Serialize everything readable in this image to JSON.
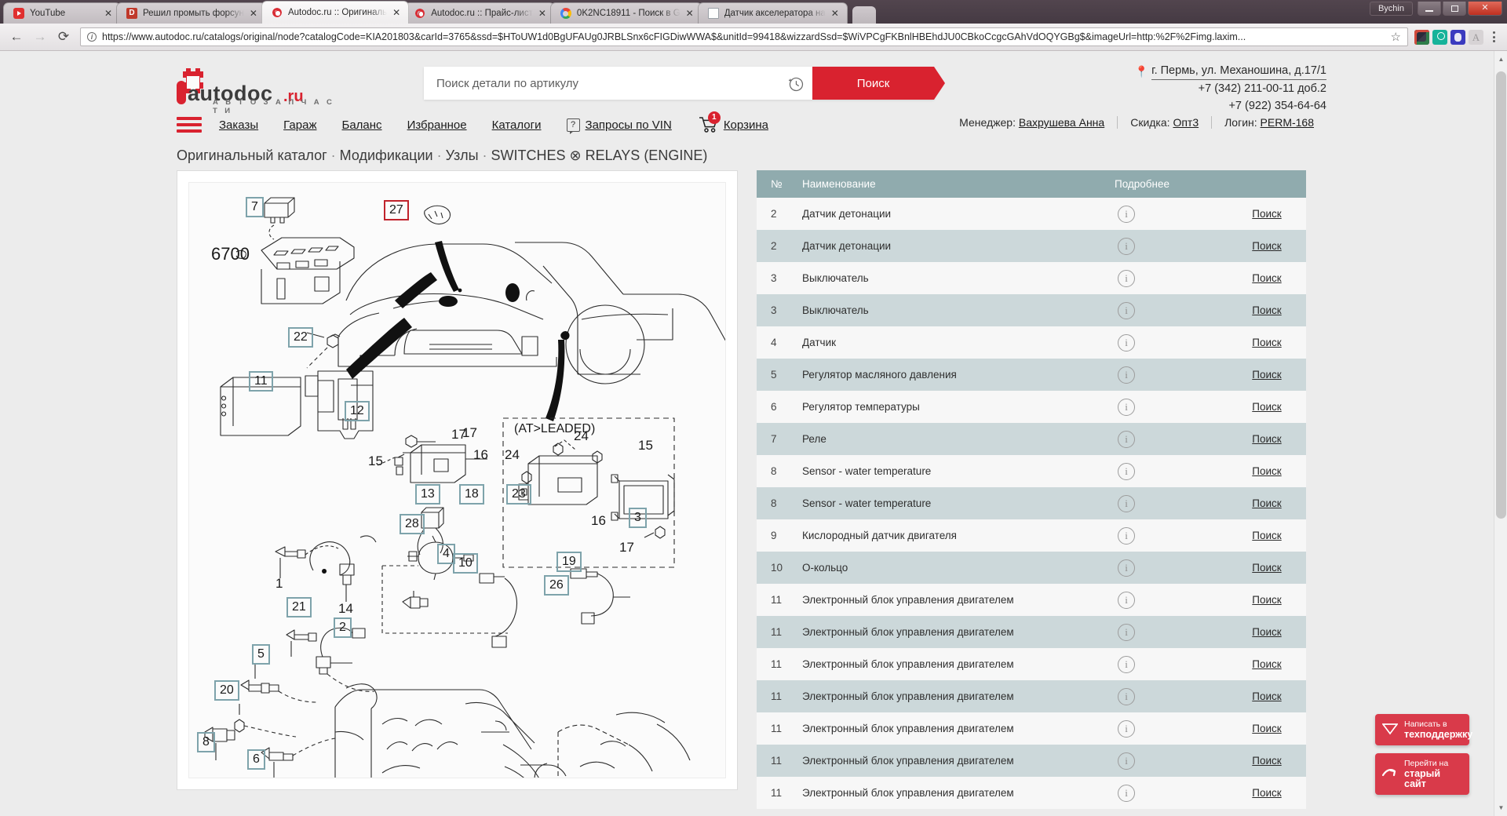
{
  "browser": {
    "tabs": [
      {
        "title": "YouTube",
        "icon": "youtube-icon",
        "active": false
      },
      {
        "title": "Решил промыть форсун",
        "icon": "drive2-icon",
        "active": false
      },
      {
        "title": "Autodoc.ru :: Оригиналь",
        "icon": "autodoc-icon",
        "active": true
      },
      {
        "title": "Autodoc.ru :: Прайс-лист",
        "icon": "autodoc-icon",
        "active": false
      },
      {
        "title": "0K2NC18911 - Поиск в G",
        "icon": "google-icon",
        "active": false
      },
      {
        "title": "Датчик акселератора на",
        "icon": "page-icon",
        "active": false
      }
    ],
    "tab_close_label": "✕",
    "user_chip": "Bychin",
    "window_buttons": {
      "minimize": "—",
      "maximize": "❐",
      "close": "✕"
    },
    "url": "https://www.autodoc.ru/catalogs/original/node?catalogCode=KIA201803&carId=3765&ssd=$HToUW1d0BgUFAUg0JRBLSnx6cFIGDiwWWA$&unitId=99418&wizzardSsd=$WiVPCgFKBnlHBEhdJU0CBkoCcgcGAhVdOQYGBg$&imageUrl=http:%2F%2Fimg.laxim...",
    "nav": {
      "back": "←",
      "forward": "→",
      "reload": "C"
    },
    "extensions": [
      "puzzle-extension-icon",
      "adguard-icon",
      "music-extension-icon",
      "pdf-extension-icon"
    ],
    "menu": "kebab-menu-icon"
  },
  "site": {
    "logo": {
      "name": "autodoc",
      "domain": ".ru",
      "tagline": "А В Т О З А П Ч А С Т И"
    },
    "search": {
      "placeholder": "Поиск детали по артикулу",
      "value": "",
      "button": "Поиск",
      "history_icon": "history-clock-icon"
    },
    "contact": {
      "address": "г. Пермь, ул. Механошина, д.17/1",
      "phone1": "+7 (342) 211-00-11 доб.2",
      "phone2": "+7 (922) 354-64-64"
    },
    "nav": {
      "menu_icon": "burger-menu-icon",
      "items": [
        {
          "label": "Заказы",
          "name": "nav-orders"
        },
        {
          "label": "Гараж",
          "name": "nav-garage"
        },
        {
          "label": "Баланс",
          "name": "nav-balance"
        },
        {
          "label": "Избранное",
          "name": "nav-favorites"
        },
        {
          "label": "Каталоги",
          "name": "nav-catalogs"
        }
      ],
      "vin": {
        "label": "Запросы по VIN",
        "icon": "question-tooltip-icon"
      },
      "cart": {
        "label": "Корзина",
        "count": "1",
        "icon": "cart-icon"
      }
    },
    "account": {
      "manager_label": "Менеджер:",
      "manager_name": "Вахрушева Анна",
      "discount_label": "Скидка:",
      "discount_value": "Опт3",
      "login_label": "Логин:",
      "login_value": "PERM-168"
    },
    "breadcrumb": {
      "items": [
        "Оригинальный каталог",
        "Модификации",
        "Узлы",
        "SWITCHES ⊗ RELAYS (ENGINE)"
      ],
      "separator": "·"
    },
    "float_buttons": [
      {
        "line1": "Написать в",
        "line2": "техподдержку",
        "icon": "send-plane-icon"
      },
      {
        "line1": "Перейти на",
        "line2": "старый сайт",
        "icon": "arrow-right-icon"
      }
    ]
  },
  "diagram": {
    "title": "SWITCHES ⊗ RELAYS (ENGINE)",
    "inset_label": "(AT>LEADED)",
    "plain_labels": [
      "6700",
      "24",
      "24",
      "15",
      "16",
      "17",
      "15",
      "16",
      "17",
      "1",
      "14"
    ],
    "highlighted_callout": "27",
    "callouts": [
      "7",
      "27",
      "6700",
      "22",
      "11",
      "12",
      "15",
      "17",
      "16",
      "24",
      "15",
      "16",
      "17",
      "13",
      "18",
      "23",
      "3",
      "1",
      "14",
      "28",
      "4",
      "10",
      "21",
      "2",
      "5",
      "19",
      "26",
      "20",
      "8",
      "6"
    ]
  },
  "table": {
    "columns": [
      "№",
      "Наименование",
      "Подробнее",
      ""
    ],
    "info_icon": "info-circle-icon",
    "action_label": "Поиск",
    "rows": [
      {
        "num": "2",
        "name": "Датчик детонации"
      },
      {
        "num": "2",
        "name": "Датчик детонации"
      },
      {
        "num": "3",
        "name": "Выключатель"
      },
      {
        "num": "3",
        "name": "Выключатель"
      },
      {
        "num": "4",
        "name": "Датчик"
      },
      {
        "num": "5",
        "name": "Регулятор масляного давления"
      },
      {
        "num": "6",
        "name": "Регулятор температуры"
      },
      {
        "num": "7",
        "name": "Реле"
      },
      {
        "num": "8",
        "name": "Sensor - water temperature"
      },
      {
        "num": "8",
        "name": "Sensor - water temperature"
      },
      {
        "num": "9",
        "name": "Кислородный датчик двигателя"
      },
      {
        "num": "10",
        "name": "О-кольцо"
      },
      {
        "num": "11",
        "name": "Электронный блок управления двигателем"
      },
      {
        "num": "11",
        "name": "Электронный блок управления двигателем"
      },
      {
        "num": "11",
        "name": "Электронный блок управления двигателем"
      },
      {
        "num": "11",
        "name": "Электронный блок управления двигателем"
      },
      {
        "num": "11",
        "name": "Электронный блок управления двигателем"
      },
      {
        "num": "11",
        "name": "Электронный блок управления двигателем"
      },
      {
        "num": "11",
        "name": "Электронный блок управления двигателем"
      }
    ]
  },
  "colors": {
    "brand_red": "#d9222f",
    "table_header": "#90abae",
    "row_even": "#ccd8da",
    "row_odd": "#f7f7f7",
    "callout_border": "#7ea3ab",
    "highlight_border": "#c0232c"
  }
}
